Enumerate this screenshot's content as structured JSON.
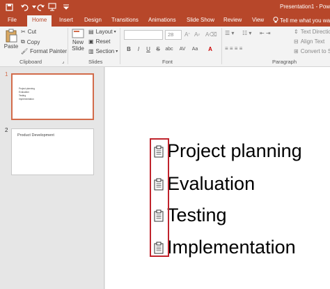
{
  "titlebar": {
    "title": "Presentation1 - Powe",
    "quick_access": [
      "save-icon",
      "undo-icon",
      "redo-icon",
      "presenter-icon"
    ],
    "accent_color": "#b7472a"
  },
  "tabs": {
    "items": [
      "File",
      "Home",
      "Insert",
      "Design",
      "Transitions",
      "Animations",
      "Slide Show",
      "Review",
      "View"
    ],
    "active": "Home",
    "tell_me": "Tell me what you want to"
  },
  "ribbon": {
    "clipboard": {
      "paste": "Paste",
      "cut": "Cut",
      "copy": "Copy",
      "format_painter": "Format Painter",
      "label": "Clipboard"
    },
    "slides": {
      "new_slide_1": "New",
      "new_slide_2": "Slide",
      "layout": "Layout",
      "reset": "Reset",
      "section": "Section",
      "label": "Slides"
    },
    "font": {
      "font_size": "28",
      "bold": "B",
      "italic": "I",
      "underline": "U",
      "strike": "S",
      "shadow": "abc",
      "spacing": "AV",
      "case": "Aa",
      "label": "Font"
    },
    "paragraph": {
      "text_direction": "Text Direction",
      "align_text": "Align Text",
      "convert": "Convert to S",
      "label": "Paragraph"
    }
  },
  "thumbnails": [
    {
      "number": "1",
      "lines": [
        "Project planning",
        "Evaluation",
        "Testing",
        "Implementation"
      ],
      "selected": true
    },
    {
      "number": "2",
      "title": "Product Development",
      "selected": false
    }
  ],
  "slide": {
    "bullets": [
      "Project planning",
      "Evaluation",
      "Testing",
      "Implementation"
    ],
    "bullet_icon": "clipboard-icon",
    "highlight_color": "#c0232c"
  }
}
